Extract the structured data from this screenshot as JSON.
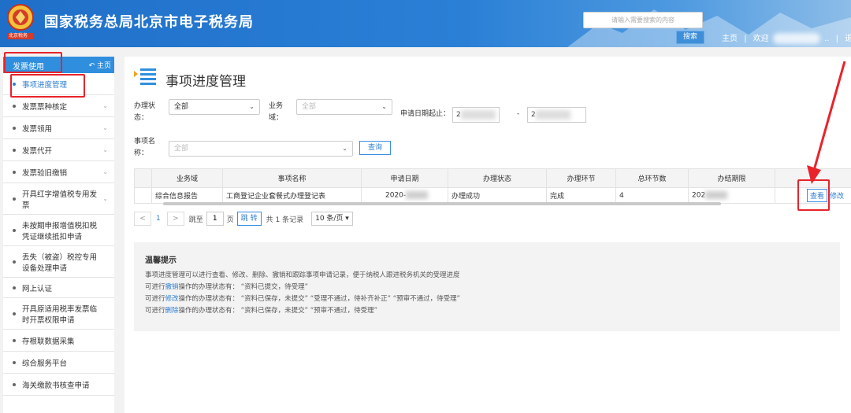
{
  "header": {
    "title": "国家税务总局北京市电子税务局",
    "logo_text": "北京税务",
    "search_placeholder": "请输入需要搜索的内容",
    "search_btn": "搜索",
    "home": "主页",
    "sep1": "|",
    "welcome": "欢迎",
    "ellipsis": "..",
    "sep2": "|",
    "logout": "退出"
  },
  "sidebar": {
    "title": "发票使用",
    "home_label": "主页",
    "items": [
      {
        "label": "事项进度管理",
        "active": true,
        "expand": false
      },
      {
        "label": "发票票种核定",
        "expand": true
      },
      {
        "label": "发票领用",
        "expand": true
      },
      {
        "label": "发票代开",
        "expand": true
      },
      {
        "label": "发票验旧缴销",
        "expand": true
      },
      {
        "label": "开具红字增值税专用发票",
        "expand": true
      },
      {
        "label": "未按期申报增值税扣税凭证继续抵扣申请",
        "expand": false
      },
      {
        "label": "丢失（被盗）税控专用设备处理申请",
        "expand": false
      },
      {
        "label": "网上认证",
        "expand": false
      },
      {
        "label": "开具原适用税率发票临时开票权限申请",
        "expand": false
      },
      {
        "label": "存根联数据采集",
        "expand": false
      },
      {
        "label": "综合服务平台",
        "expand": false
      },
      {
        "label": "海关缴款书核查申请",
        "expand": false
      }
    ]
  },
  "main": {
    "title": "事项进度管理",
    "filters": {
      "status_label": "办理状态：",
      "status_value": "全部",
      "domain_label": "业务域：",
      "domain_value": "全部",
      "date_label": "申请日期起止：",
      "date_from": "2",
      "date_sep": "-",
      "date_to": "2",
      "item_label": "事项名称：",
      "item_value": "全部",
      "query_btn": "查询"
    },
    "table": {
      "headers": [
        "",
        "业务域",
        "事项名称",
        "申请日期",
        "办理状态",
        "办理环节",
        "总环节数",
        "办结期限",
        ""
      ],
      "rows": [
        {
          "domain": "综合信息报告",
          "name": "工商登记企业套餐式办理登记表",
          "date": "2020-",
          "status": "办理成功",
          "step": "完成",
          "total": "4",
          "deadline": "202",
          "view": "查看",
          "modify": "修改"
        }
      ]
    },
    "pager": {
      "prev": "<",
      "page": "1",
      "next": ">",
      "goto_label": "跳至",
      "goto_value": "1",
      "page_unit": "页",
      "go_btn": "跳 转",
      "total": "共 1 条记录",
      "page_size": "10 条/页 ▾"
    },
    "tips": {
      "title": "温馨提示",
      "line1": "事项进度管理可以进行查看、修改、删除、撤销和跟踪事项申请记录，便于纳税人跟进税务机关的受理进度",
      "line2_pre": "可进行",
      "line2_hl": "撤销",
      "line2_post": "操作的办理状态有：  “资料已提交，待受理”",
      "line3_pre": "可进行",
      "line3_hl": "修改",
      "line3_post": "操作的办理状态有：  “资料已保存，未提交”    “受理不通过，待补齐补正”    “预审不通过，待受理”",
      "line4_pre": "可进行",
      "line4_hl": "删除",
      "line4_post": "操作的办理状态有：  “资料已保存，未提交”    “预审不通过，待受理”"
    }
  },
  "colors": {
    "header_blue": "#2b80d6",
    "accent": "#2f7fd0",
    "annotation_red": "#e8232a"
  }
}
